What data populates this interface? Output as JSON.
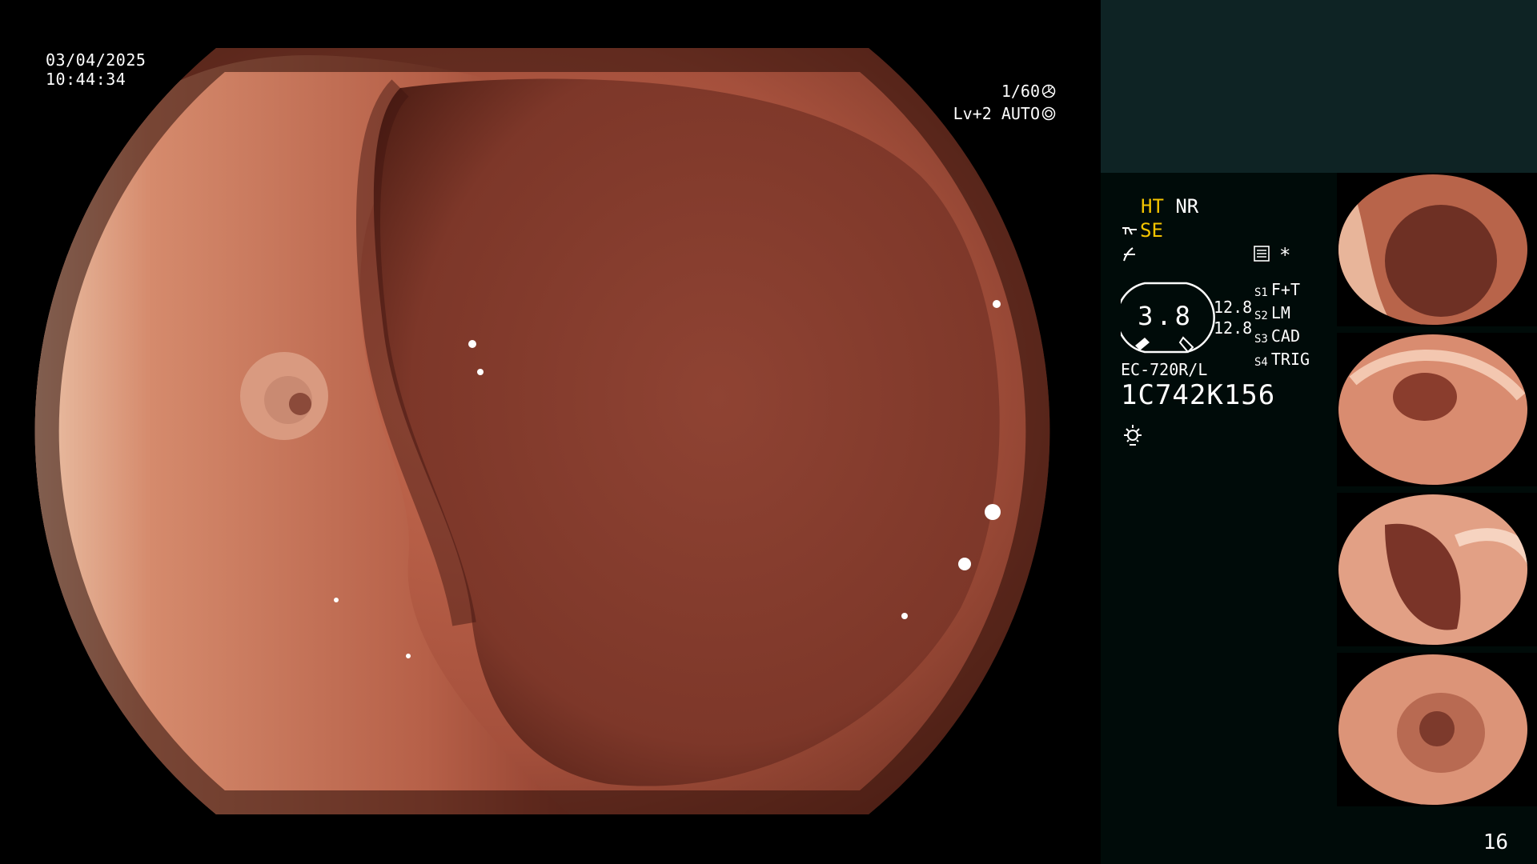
{
  "main_view": {
    "date": "03/04/2025",
    "time": "10:44:34",
    "shutter": "1/60",
    "light_mode": "Lv+2 AUTO"
  },
  "panel": {
    "mode_ht": "HT",
    "mode_nr": "NR",
    "mode_se": "SE",
    "dial_value": "3.8",
    "sensitivity_1": "12.8",
    "sensitivity_2": "12.8",
    "switches": [
      {
        "key": "S1",
        "label": "F+T"
      },
      {
        "key": "S2",
        "label": "LM"
      },
      {
        "key": "S3",
        "label": "CAD"
      },
      {
        "key": "S4",
        "label": "TRIG"
      }
    ],
    "star": "*",
    "scope_model": "EC-720R/L",
    "scope_serial": "1C742K156",
    "frame_count": "16"
  },
  "colors": {
    "accent_yellow": "#f5c400",
    "panel_bg": "#000b09",
    "panel_top": "#0e2324",
    "mucosa": "#a4503a"
  },
  "icons": [
    "shutter-icon",
    "iris-icon",
    "structure-enhance-icon",
    "color-tone-icon",
    "document-icon",
    "lamp-icon",
    "scope-dial-icon"
  ]
}
